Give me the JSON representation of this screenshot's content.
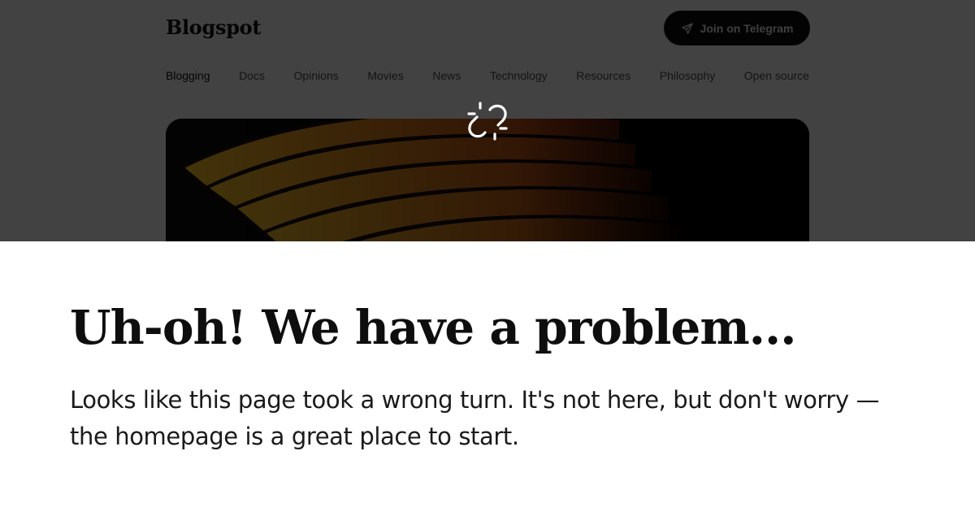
{
  "header": {
    "brand": "Blogspot",
    "cta_label": "Join on Telegram",
    "cta_icon": "send-icon"
  },
  "nav": {
    "items": [
      {
        "label": "Blogging",
        "active": true
      },
      {
        "label": "Docs"
      },
      {
        "label": "Opinions"
      },
      {
        "label": "Movies"
      },
      {
        "label": "News"
      },
      {
        "label": "Technology"
      },
      {
        "label": "Resources"
      },
      {
        "label": "Philosophy"
      },
      {
        "label": "Open source"
      }
    ]
  },
  "hero": {
    "image": "abstract-orange-layered-shapes",
    "colors": [
      "#f2b51c",
      "#e5571b",
      "#0a0a0a"
    ]
  },
  "overlay": {
    "icon": "broken-link-icon",
    "dim_color": "#000000"
  },
  "error": {
    "headline": "Uh-oh! We have a problem...",
    "body": "Looks like this page took a wrong turn. It's not here, but don't worry —the homepage is a great place to start."
  }
}
